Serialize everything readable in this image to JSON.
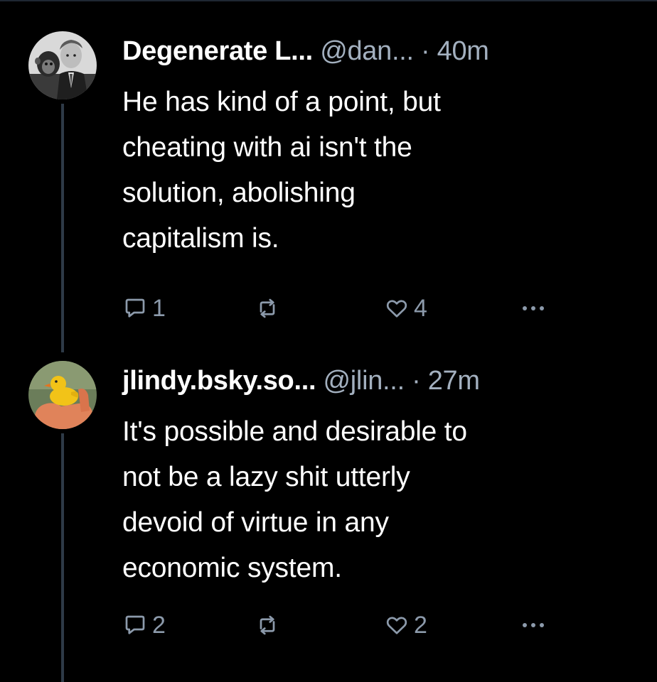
{
  "posts": [
    {
      "display_name": "Degenerate L...",
      "handle": "@dan...",
      "separator": " · ",
      "time": "40m",
      "text": "He has kind of a point, but cheating with ai isn't the solution, abolishing capitalism is.",
      "lines": [
        "He has kind of a point, but",
        "cheating with ai isn't the",
        "solution, abolishing",
        "capitalism is."
      ],
      "replies": "1",
      "likes": "4",
      "avatar_icon": "avatar-man-with-chimp"
    },
    {
      "display_name": "jlindy.bsky.so...",
      "handle": "@jlin...",
      "separator": "  · ",
      "time": "27m",
      "lines": [
        "It's possible and desirable to",
        "not be a lazy shit utterly",
        "devoid of virtue in any",
        "economic system."
      ],
      "replies": "2",
      "likes": "2",
      "avatar_icon": "avatar-rubber-duck"
    }
  ],
  "icons": {
    "reply": "reply-icon",
    "repost": "repost-icon",
    "like": "heart-icon",
    "more": "more-icon"
  },
  "colors": {
    "background": "#000000",
    "text": "#ffffff",
    "muted": "#a3b0bf",
    "action": "#8c9aab",
    "thread_line": "#2e3a47"
  }
}
